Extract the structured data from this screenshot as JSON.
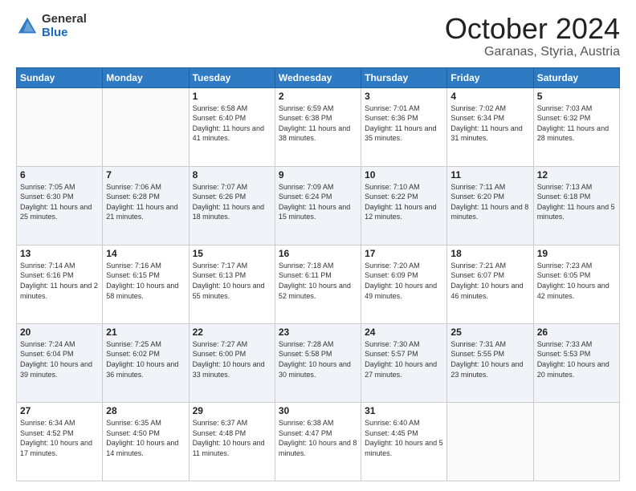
{
  "header": {
    "logo_general": "General",
    "logo_blue": "Blue",
    "month_title": "October 2024",
    "location": "Garanas, Styria, Austria"
  },
  "days_of_week": [
    "Sunday",
    "Monday",
    "Tuesday",
    "Wednesday",
    "Thursday",
    "Friday",
    "Saturday"
  ],
  "weeks": [
    [
      {
        "day": "",
        "info": ""
      },
      {
        "day": "",
        "info": ""
      },
      {
        "day": "1",
        "info": "Sunrise: 6:58 AM\nSunset: 6:40 PM\nDaylight: 11 hours and 41 minutes."
      },
      {
        "day": "2",
        "info": "Sunrise: 6:59 AM\nSunset: 6:38 PM\nDaylight: 11 hours and 38 minutes."
      },
      {
        "day": "3",
        "info": "Sunrise: 7:01 AM\nSunset: 6:36 PM\nDaylight: 11 hours and 35 minutes."
      },
      {
        "day": "4",
        "info": "Sunrise: 7:02 AM\nSunset: 6:34 PM\nDaylight: 11 hours and 31 minutes."
      },
      {
        "day": "5",
        "info": "Sunrise: 7:03 AM\nSunset: 6:32 PM\nDaylight: 11 hours and 28 minutes."
      }
    ],
    [
      {
        "day": "6",
        "info": "Sunrise: 7:05 AM\nSunset: 6:30 PM\nDaylight: 11 hours and 25 minutes."
      },
      {
        "day": "7",
        "info": "Sunrise: 7:06 AM\nSunset: 6:28 PM\nDaylight: 11 hours and 21 minutes."
      },
      {
        "day": "8",
        "info": "Sunrise: 7:07 AM\nSunset: 6:26 PM\nDaylight: 11 hours and 18 minutes."
      },
      {
        "day": "9",
        "info": "Sunrise: 7:09 AM\nSunset: 6:24 PM\nDaylight: 11 hours and 15 minutes."
      },
      {
        "day": "10",
        "info": "Sunrise: 7:10 AM\nSunset: 6:22 PM\nDaylight: 11 hours and 12 minutes."
      },
      {
        "day": "11",
        "info": "Sunrise: 7:11 AM\nSunset: 6:20 PM\nDaylight: 11 hours and 8 minutes."
      },
      {
        "day": "12",
        "info": "Sunrise: 7:13 AM\nSunset: 6:18 PM\nDaylight: 11 hours and 5 minutes."
      }
    ],
    [
      {
        "day": "13",
        "info": "Sunrise: 7:14 AM\nSunset: 6:16 PM\nDaylight: 11 hours and 2 minutes."
      },
      {
        "day": "14",
        "info": "Sunrise: 7:16 AM\nSunset: 6:15 PM\nDaylight: 10 hours and 58 minutes."
      },
      {
        "day": "15",
        "info": "Sunrise: 7:17 AM\nSunset: 6:13 PM\nDaylight: 10 hours and 55 minutes."
      },
      {
        "day": "16",
        "info": "Sunrise: 7:18 AM\nSunset: 6:11 PM\nDaylight: 10 hours and 52 minutes."
      },
      {
        "day": "17",
        "info": "Sunrise: 7:20 AM\nSunset: 6:09 PM\nDaylight: 10 hours and 49 minutes."
      },
      {
        "day": "18",
        "info": "Sunrise: 7:21 AM\nSunset: 6:07 PM\nDaylight: 10 hours and 46 minutes."
      },
      {
        "day": "19",
        "info": "Sunrise: 7:23 AM\nSunset: 6:05 PM\nDaylight: 10 hours and 42 minutes."
      }
    ],
    [
      {
        "day": "20",
        "info": "Sunrise: 7:24 AM\nSunset: 6:04 PM\nDaylight: 10 hours and 39 minutes."
      },
      {
        "day": "21",
        "info": "Sunrise: 7:25 AM\nSunset: 6:02 PM\nDaylight: 10 hours and 36 minutes."
      },
      {
        "day": "22",
        "info": "Sunrise: 7:27 AM\nSunset: 6:00 PM\nDaylight: 10 hours and 33 minutes."
      },
      {
        "day": "23",
        "info": "Sunrise: 7:28 AM\nSunset: 5:58 PM\nDaylight: 10 hours and 30 minutes."
      },
      {
        "day": "24",
        "info": "Sunrise: 7:30 AM\nSunset: 5:57 PM\nDaylight: 10 hours and 27 minutes."
      },
      {
        "day": "25",
        "info": "Sunrise: 7:31 AM\nSunset: 5:55 PM\nDaylight: 10 hours and 23 minutes."
      },
      {
        "day": "26",
        "info": "Sunrise: 7:33 AM\nSunset: 5:53 PM\nDaylight: 10 hours and 20 minutes."
      }
    ],
    [
      {
        "day": "27",
        "info": "Sunrise: 6:34 AM\nSunset: 4:52 PM\nDaylight: 10 hours and 17 minutes."
      },
      {
        "day": "28",
        "info": "Sunrise: 6:35 AM\nSunset: 4:50 PM\nDaylight: 10 hours and 14 minutes."
      },
      {
        "day": "29",
        "info": "Sunrise: 6:37 AM\nSunset: 4:48 PM\nDaylight: 10 hours and 11 minutes."
      },
      {
        "day": "30",
        "info": "Sunrise: 6:38 AM\nSunset: 4:47 PM\nDaylight: 10 hours and 8 minutes."
      },
      {
        "day": "31",
        "info": "Sunrise: 6:40 AM\nSunset: 4:45 PM\nDaylight: 10 hours and 5 minutes."
      },
      {
        "day": "",
        "info": ""
      },
      {
        "day": "",
        "info": ""
      }
    ]
  ]
}
